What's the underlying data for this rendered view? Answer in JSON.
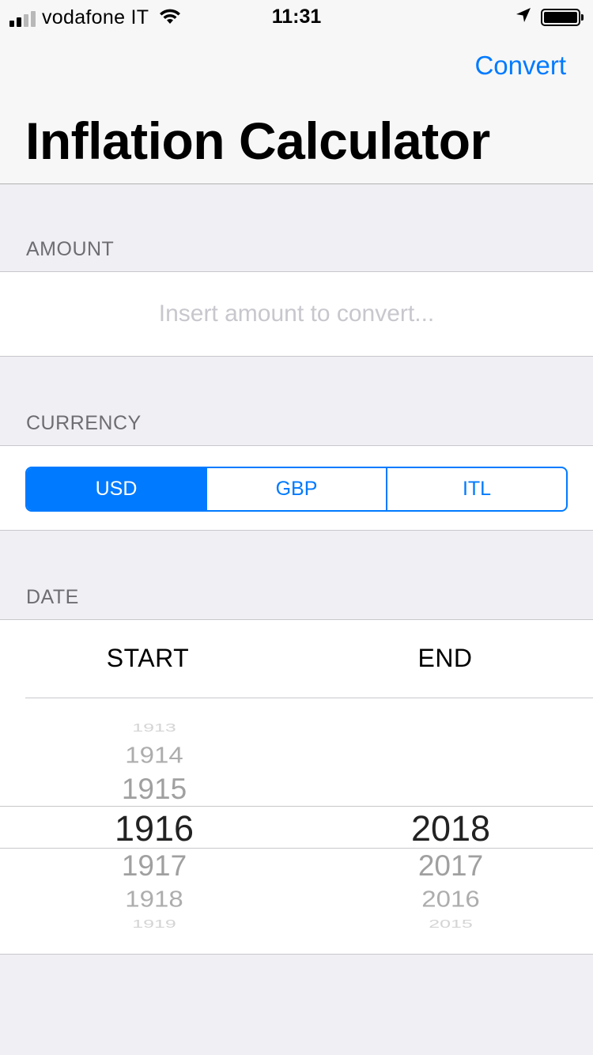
{
  "status_bar": {
    "carrier": "vodafone IT",
    "time": "11:31",
    "signal_bars_filled": 2,
    "signal_bars_total": 4,
    "icons": [
      "signal-icon",
      "wifi-icon",
      "location-arrow-icon",
      "battery-icon"
    ]
  },
  "nav": {
    "convert_label": "Convert",
    "title": "Inflation Calculator"
  },
  "amount": {
    "header": "AMOUNT",
    "value": "",
    "placeholder": "Insert amount to convert..."
  },
  "currency": {
    "header": "CURRENCY",
    "options": [
      "USD",
      "GBP",
      "ITL"
    ],
    "selected": "USD"
  },
  "date": {
    "header": "DATE",
    "start_label": "START",
    "end_label": "END",
    "start_picker": {
      "items": [
        "1913",
        "1914",
        "1915",
        "1916",
        "1917",
        "1918",
        "1919"
      ],
      "selected": "1916"
    },
    "end_picker": {
      "items": [
        "2018",
        "2017",
        "2016",
        "2015"
      ],
      "selected": "2018"
    }
  },
  "colors": {
    "accent": "#007aff",
    "background": "#efeff4",
    "section_header": "#6d6d72",
    "placeholder": "#c7c7cd"
  }
}
